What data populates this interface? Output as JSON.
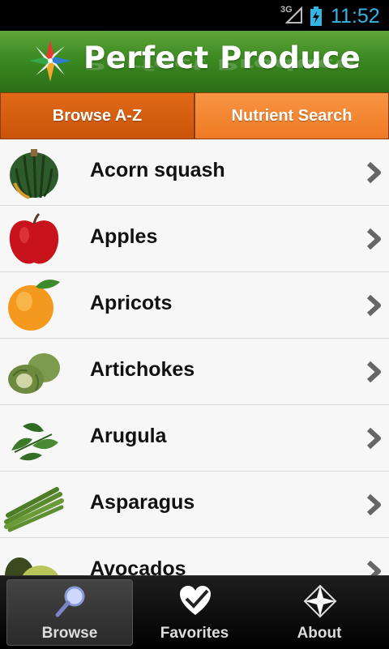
{
  "status_bar": {
    "network": "3G",
    "time": "11:52"
  },
  "header": {
    "title": "Perfect Produce",
    "logo_icon": "compass-star-icon"
  },
  "tabs": [
    {
      "label": "Browse A-Z",
      "active": true
    },
    {
      "label": "Nutrient Search",
      "active": false
    }
  ],
  "list": [
    {
      "label": "Acorn squash",
      "thumb": "acorn-squash"
    },
    {
      "label": "Apples",
      "thumb": "apple"
    },
    {
      "label": "Apricots",
      "thumb": "apricot"
    },
    {
      "label": "Artichokes",
      "thumb": "artichoke"
    },
    {
      "label": "Arugula",
      "thumb": "arugula"
    },
    {
      "label": "Asparagus",
      "thumb": "asparagus"
    },
    {
      "label": "Avocados",
      "thumb": "avocado"
    }
  ],
  "bottom_nav": [
    {
      "label": "Browse",
      "icon": "magnifier-icon",
      "active": true
    },
    {
      "label": "Favorites",
      "icon": "heart-check-icon",
      "active": false
    },
    {
      "label": "About",
      "icon": "compass-star-icon",
      "active": false
    }
  ],
  "colors": {
    "header_green": "#3c8a22",
    "tab_orange_active": "#d15d0e",
    "tab_orange": "#f4882f",
    "status_blue": "#33b5e5"
  }
}
